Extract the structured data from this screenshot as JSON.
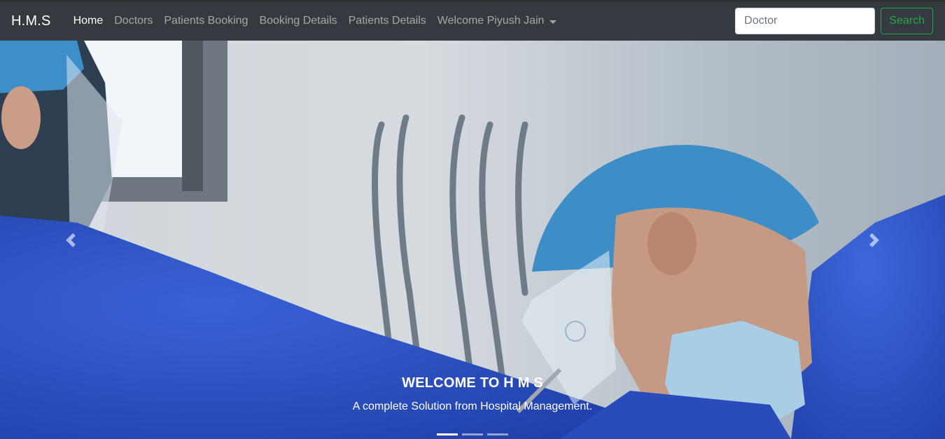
{
  "navbar": {
    "brand": "H.M.S",
    "links": [
      {
        "label": "Home",
        "active": true
      },
      {
        "label": "Doctors",
        "active": false
      },
      {
        "label": "Patients Booking",
        "active": false
      },
      {
        "label": "Booking Details",
        "active": false
      },
      {
        "label": "Patients Details",
        "active": false
      }
    ],
    "user_menu": "Welcome Piyush Jain",
    "search": {
      "placeholder": "Doctor",
      "value": "",
      "button_label": "Search"
    }
  },
  "carousel": {
    "caption_title": "WELCOME TO H M S",
    "caption_text": "A complete Solution from Hospital Management.",
    "slide_count": 3,
    "active_slide": 1
  },
  "colors": {
    "navbar_bg": "#343a40",
    "search_button": "#28a745",
    "scrub_blue": "#2f55c9",
    "cap_blue": "#3d8ec6",
    "mask_blue": "#9ec4dc"
  },
  "icons": [
    "chevron-left-icon",
    "chevron-right-icon",
    "caret-down-icon"
  ]
}
